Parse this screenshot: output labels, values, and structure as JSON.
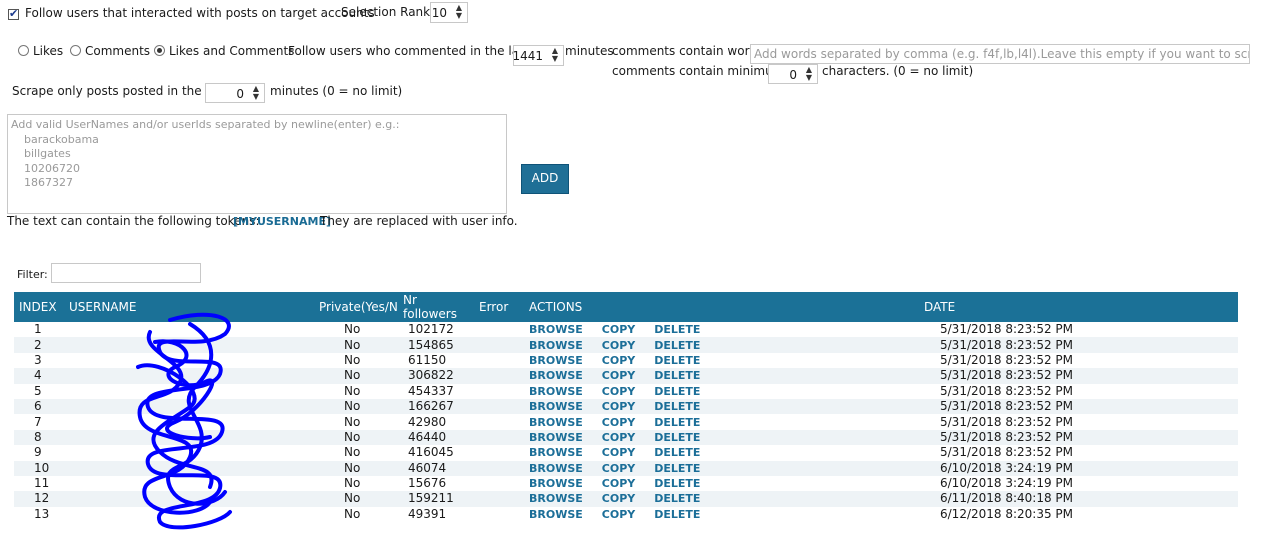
{
  "top": {
    "follow_label": "Follow users that interacted with posts on target accounts",
    "selection_rank_label": "Selection Rank",
    "selection_rank_value": "10"
  },
  "interaction": {
    "options": [
      "Likes",
      "Comments",
      "Likes and Comments"
    ],
    "selected": "Likes and Comments",
    "commented_label": "Follow users who commented in the last",
    "minutes_value": "1441",
    "minutes_label": "minutes",
    "comments_words_label": "comments contain words",
    "words_placeholder": "Add words separated by comma (e.g. f4f,lb,l4l).Leave this empty if you want to scrape all comm",
    "comments_min_label": "comments contain minimum",
    "min_chars_value": "0",
    "chars_label": "characters. (0 = no limit)"
  },
  "scrape": {
    "label": "Scrape only posts posted in the last",
    "value": "0",
    "suffix": "minutes (0 = no limit)"
  },
  "usernames_box": {
    "placeholder_lines": [
      "Add valid UserNames and/or userIds separated by newline(enter) e.g.:",
      "barackobama",
      "billgates",
      "10206720",
      "1867327"
    ]
  },
  "add_button": "ADD",
  "tokens_line": {
    "prefix": "The text can contain the following tokens:",
    "token": "[MYUSERNAME]",
    "suffix": "They are replaced with user info."
  },
  "filter": {
    "label": "Filter:",
    "value": ""
  },
  "table": {
    "headers": [
      "INDEX",
      "USERNAME",
      "Private(Yes/N",
      "Nr followers",
      "Error",
      "ACTIONS",
      "DATE"
    ],
    "actions": [
      "BROWSE",
      "COPY",
      "DELETE"
    ],
    "rows": [
      {
        "index": "1",
        "private": "No",
        "followers": "102172",
        "date": "5/31/2018 8:23:52 PM"
      },
      {
        "index": "2",
        "private": "No",
        "followers": "154865",
        "date": "5/31/2018 8:23:52 PM"
      },
      {
        "index": "3",
        "private": "No",
        "followers": "61150",
        "date": "5/31/2018 8:23:52 PM"
      },
      {
        "index": "4",
        "private": "No",
        "followers": "306822",
        "date": "5/31/2018 8:23:52 PM"
      },
      {
        "index": "5",
        "private": "No",
        "followers": "454337",
        "date": "5/31/2018 8:23:52 PM"
      },
      {
        "index": "6",
        "private": "No",
        "followers": "166267",
        "date": "5/31/2018 8:23:52 PM"
      },
      {
        "index": "7",
        "private": "No",
        "followers": "42980",
        "date": "5/31/2018 8:23:52 PM"
      },
      {
        "index": "8",
        "private": "No",
        "followers": "46440",
        "date": "5/31/2018 8:23:52 PM"
      },
      {
        "index": "9",
        "private": "No",
        "followers": "416045",
        "date": "5/31/2018 8:23:52 PM"
      },
      {
        "index": "10",
        "private": "No",
        "followers": "46074",
        "date": "6/10/2018 3:24:19 PM"
      },
      {
        "index": "11",
        "private": "No",
        "followers": "15676",
        "date": "6/10/2018 3:24:19 PM"
      },
      {
        "index": "12",
        "private": "No",
        "followers": "159211",
        "date": "6/11/2018 8:40:18 PM"
      },
      {
        "index": "13",
        "private": "No",
        "followers": "49391",
        "date": "6/12/2018 8:20:35 PM"
      }
    ]
  },
  "colors": {
    "header_bg": "#1b7197",
    "button_bg": "#1f6f96",
    "redaction": "#0000ff",
    "action_link": "#1b6e98"
  }
}
